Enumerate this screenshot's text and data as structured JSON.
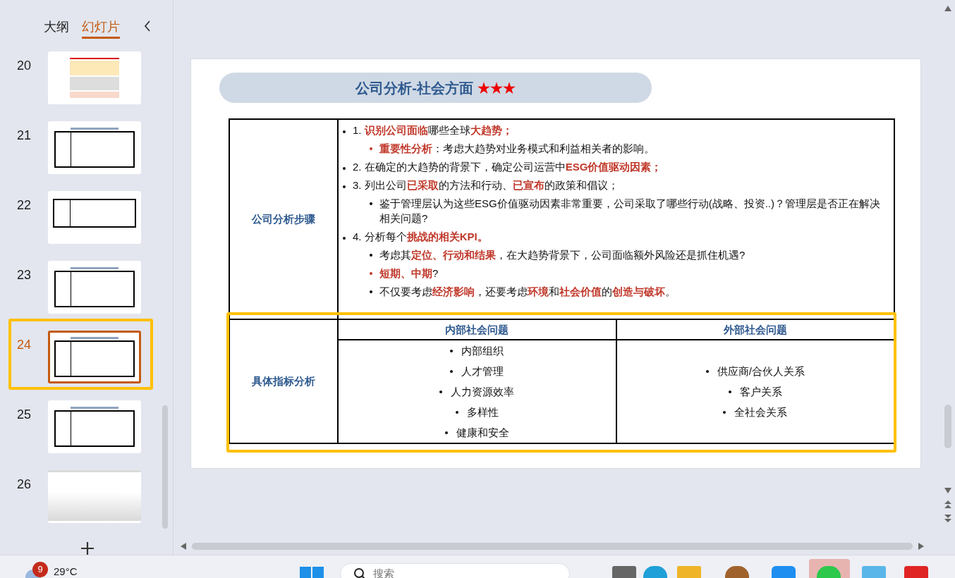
{
  "left_panel": {
    "tabs": [
      {
        "label": "大纲",
        "selected": false
      },
      {
        "label": "幻灯片",
        "selected": true
      }
    ],
    "slides": [
      {
        "number": "20",
        "kind": "color-table",
        "selected": false
      },
      {
        "number": "21",
        "kind": "table",
        "selected": false
      },
      {
        "number": "22",
        "kind": "diagram",
        "selected": false
      },
      {
        "number": "23",
        "kind": "table",
        "selected": false
      },
      {
        "number": "24",
        "kind": "table",
        "selected": true
      },
      {
        "number": "25",
        "kind": "table",
        "selected": false
      },
      {
        "number": "26",
        "kind": "photo",
        "selected": false
      }
    ]
  },
  "slide": {
    "title": "公司分析-社会方面",
    "title_stars": "★★★",
    "steps": {
      "heading": "公司分析步骤",
      "items": [
        {
          "text": "1. **识别公司面临**哪些全球**大趋势；**",
          "children": [
            {
              "text": "**重要性分析**：考虑大趋势对业务模式和利益相关者的影响。",
              "color": "#c0392b"
            }
          ]
        },
        {
          "text": "2. 在确定的大趋势的背景下，确定公司运营中**ESG价值驱动因素；**"
        },
        {
          "text": "3. 列出公司**已采取**的方法和行动、**已宣布**的政策和倡议；",
          "children": [
            {
              "text": "鉴于管理层认为这些ESG价值驱动因素非常重要，公司采取了哪些行动(战略、投资..)？管理层是否正在解决相关问题?",
              "color": "#000000"
            }
          ]
        },
        {
          "text": "4. 分析每个**挑战的相关KPI。**",
          "children": [
            {
              "text": "考虑其**定位、行动和结果**，在大趋势背景下，公司面临额外风险还是抓住机遇?",
              "color": "#000000"
            },
            {
              "text": "**短期、中期**?",
              "color": "#c0392b"
            },
            {
              "text": "不仅要考虑**经济影响**，还要考虑**环境**和**社会价值**的**创造与破坏**。",
              "color": "#000000"
            }
          ]
        }
      ]
    },
    "indicators": {
      "heading": "具体指标分析",
      "columns": [
        {
          "heading": "内部社会问题",
          "items": [
            "内部组织",
            "人才管理",
            "人力资源效率",
            "多样性",
            "健康和安全"
          ]
        },
        {
          "heading": "外部社会问题",
          "items": [
            "供应商/合伙人关系",
            "客户关系",
            "全社会关系"
          ]
        }
      ]
    }
  },
  "annotations": [
    {
      "color": "#ffc000"
    },
    {
      "color": "#ffc000"
    }
  ],
  "taskbar": {
    "weather_badge": "9",
    "temperature": "29°C",
    "search_placeholder": "搜索"
  }
}
